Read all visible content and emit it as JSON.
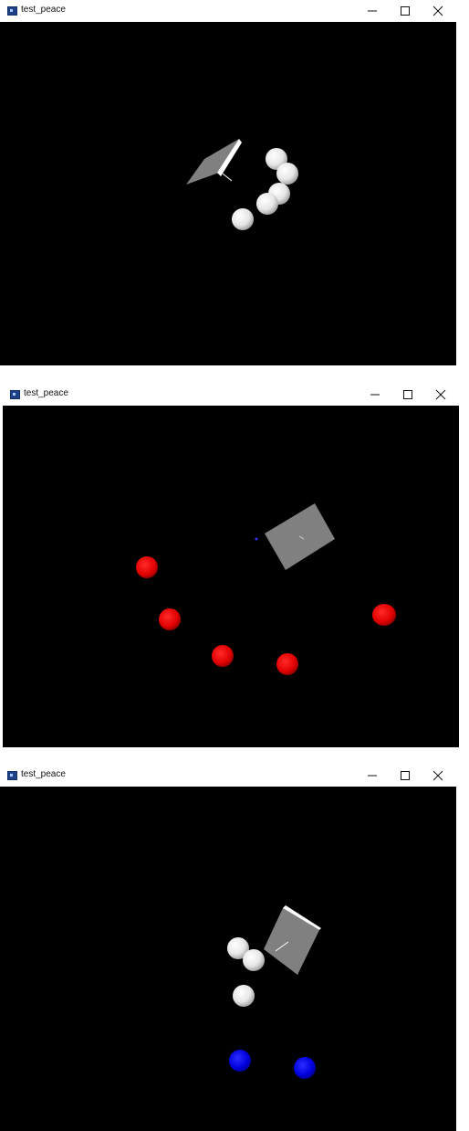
{
  "windows": [
    {
      "title": "test_peace",
      "scene": "white spheres and grey tile"
    },
    {
      "title": "test_peace",
      "scene": "red spheres and grey tile"
    },
    {
      "title": "test_peace",
      "scene": "white and blue spheres and grey tile"
    }
  ],
  "icons": {
    "app": "app-icon",
    "minimize": "minimize-icon",
    "maximize": "maximize-icon",
    "close": "close-icon"
  },
  "colors": {
    "background": "#000000",
    "tile": "#808080",
    "white_sphere": "#f0f0f0",
    "red_sphere": "#e00000",
    "blue_sphere": "#0000dd"
  }
}
